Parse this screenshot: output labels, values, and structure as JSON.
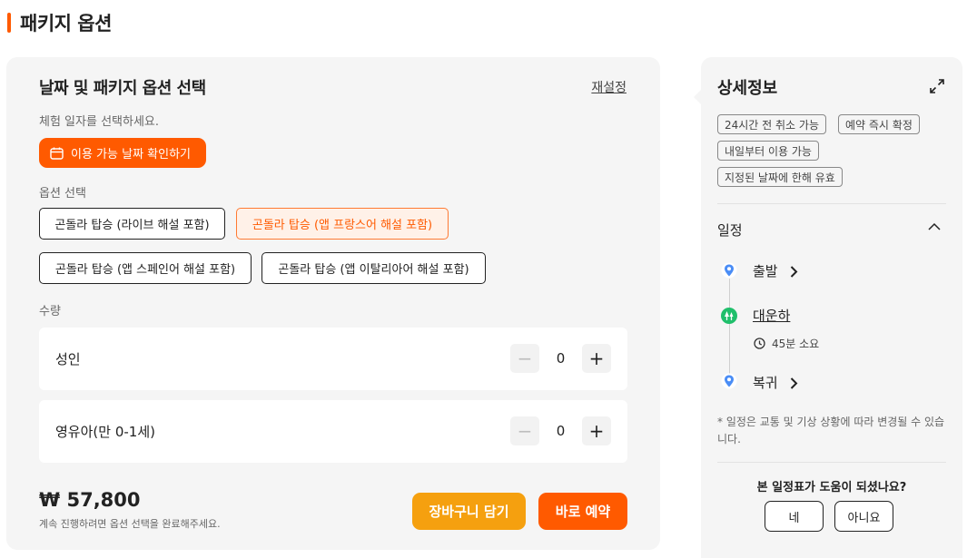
{
  "page": {
    "title": "패키지 옵션"
  },
  "main": {
    "heading": "날짜 및 패키지 옵션 선택",
    "reset_label": "재설정",
    "date_prompt": "체험 일자를 선택하세요.",
    "date_button": "이용 가능 날짜 확인하기",
    "options_label": "옵션 선택",
    "options": [
      {
        "label": "곤돌라 탑승 (라이브 해설 포함)",
        "selected": false
      },
      {
        "label": "곤돌라 탑승 (앱 프랑스어 해설 포함)",
        "selected": true
      },
      {
        "label": "곤돌라 탑승 (앱 스페인어 해설 포함)",
        "selected": false
      },
      {
        "label": "곤돌라 탑승 (앱 이탈리아어 해설 포함)",
        "selected": false
      }
    ],
    "quantity_label": "수량",
    "quantities": [
      {
        "label": "성인",
        "value": "0"
      },
      {
        "label": "영유아(만 0-1세)",
        "value": "0"
      }
    ],
    "stepper": {
      "minus": "−",
      "plus": "+"
    },
    "price": "₩ 57,800",
    "price_note": "계속 진행하려면 옵션 선택을 완료해주세요.",
    "cart_button": "장바구니 담기",
    "book_button": "바로 예약"
  },
  "side": {
    "title": "상세정보",
    "tags": [
      "24시간 전 취소 가능",
      "예약 즉시 확정",
      "내일부터 이용 가능",
      "지정된 날짜에 한해 유효"
    ],
    "schedule_title": "일정",
    "stops": [
      {
        "label": "출발",
        "icon": "location-pin-icon"
      },
      {
        "label": "대운하",
        "icon": "park-icon"
      },
      {
        "label": "복귀",
        "icon": "location-pin-icon"
      }
    ],
    "duration": "45분 소요",
    "note": "* 일정은 교통 및 기상 상황에 따라 변경될 수 있습니다.",
    "feedback_question": "본 일정표가 도움이 되셨나요?",
    "feedback_yes": "네",
    "feedback_no": "아니요"
  },
  "colors": {
    "accent": "#ff5a00",
    "cart": "#f5a00f",
    "pin": "#4a8df6",
    "park": "#1fbf6b",
    "card_bg": "#f5f5f5"
  }
}
